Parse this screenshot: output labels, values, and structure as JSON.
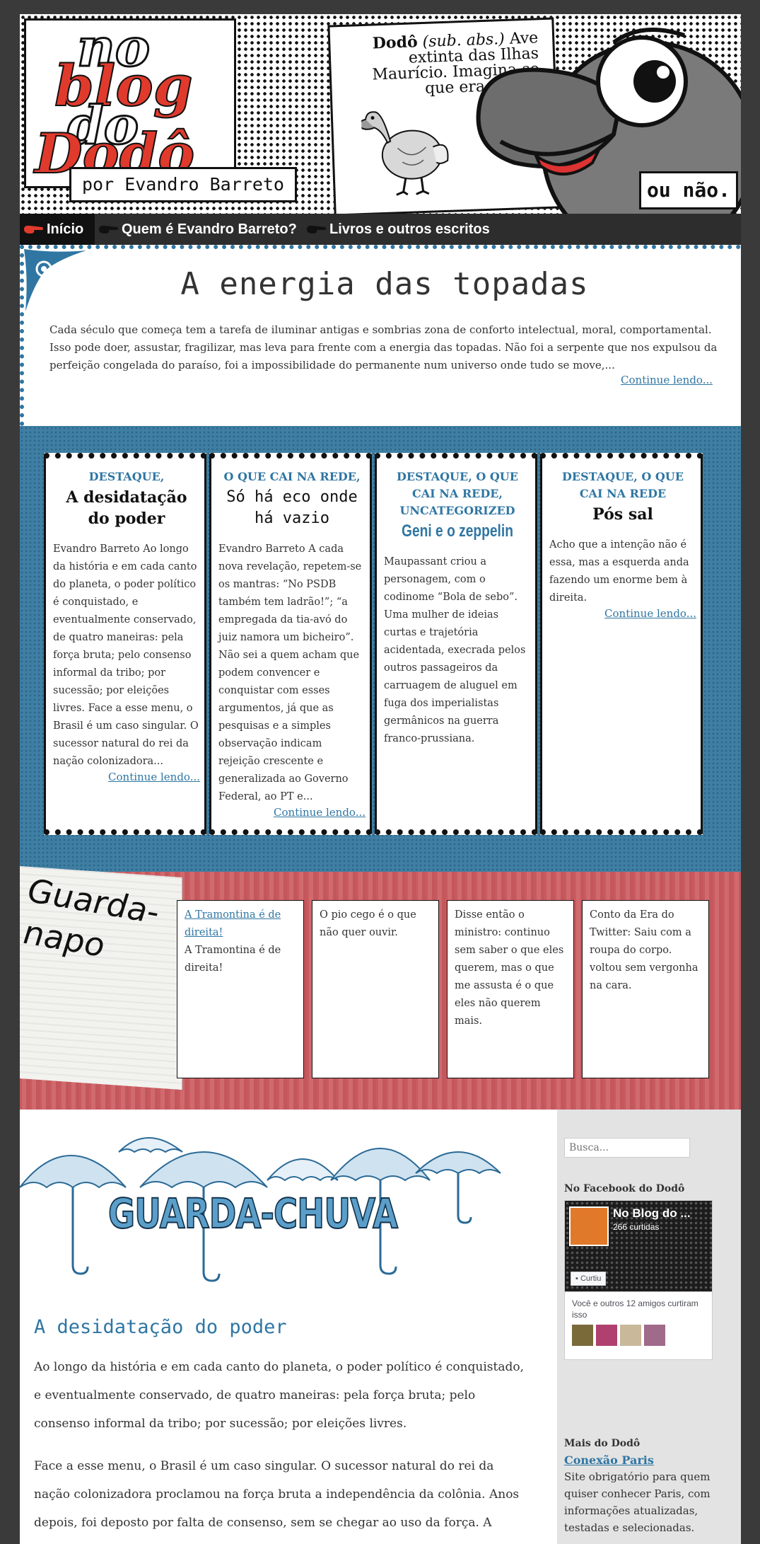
{
  "header": {
    "logo_no": "no",
    "logo_blog": "blog",
    "logo_do": "do",
    "logo_dodo": "Dodô",
    "byline": "por Evandro Barreto",
    "definition_term": "Dodô",
    "definition_abbr": "(sub. abs.)",
    "definition_text": "Ave extinta das Ilhas Maurício. Imagina-se que era assim.",
    "ou_nao": "ou não."
  },
  "nav": {
    "items": [
      {
        "label": "Início"
      },
      {
        "label": "Quem é Evandro Barreto?"
      },
      {
        "label": "Livros e outros escritos"
      }
    ]
  },
  "featured": {
    "title": "A energia das topadas",
    "excerpt": "Cada século que começa tem a tarefa de iluminar antigas e sombrias zona de conforto intelectual, moral, comportamental. Isso pode doer, assustar, fragilizar, mas leva para frente com a energia das topadas. Não foi a serpente que nos expulsou da perfeição congelada do paraíso, foi a impossibilidade do permanente num universo onde tudo se move,...",
    "more": "Continue lendo..."
  },
  "highlights": [
    {
      "category": "DESTAQUE,",
      "title": "A desidatação do poder",
      "text": "Evandro Barreto Ao longo da história e em cada canto do planeta, o poder político é conquistado, e eventualmente conservado, de quatro maneiras: pela força bruta; pelo consenso informal da tribo; por sucessão; por eleições livres. Face a esse menu, o Brasil é um caso singular. O sucessor natural do rei da nação colonizadora...",
      "more": "Continue lendo..."
    },
    {
      "category": "O QUE CAI NA REDE,",
      "title": "Só há eco onde há vazio",
      "text": "Evandro Barreto A  cada nova revelação, repetem-se os mantras: “No PSDB também tem ladrão!”;  “a empregada da tia-avó do juiz namora um bicheiro”.  Não sei a quem acham que podem convencer e conquistar com esses argumentos, já que as pesquisas e a simples observação indicam rejeição crescente e generalizada ao Governo Federal, ao PT e...",
      "more": "Continue lendo..."
    },
    {
      "category": "DESTAQUE, O QUE CAI NA REDE, UNCATEGORIZED",
      "title": "Geni e o zeppelin",
      "text": "Maupassant criou a personagem, com o codinome “Bola de sebo”. Uma mulher de ideias curtas e trajetória acidentada, execrada pelos outros passageiros da carruagem de aluguel em fuga dos imperialistas germânicos na guerra franco-prussiana.",
      "more": ""
    },
    {
      "category": "DESTAQUE, O QUE CAI NA REDE",
      "title": "Pós sal",
      "text": "Acho que a intenção não é essa, mas a esquerda anda fazendo  um enorme bem à direita.",
      "more": "Continue lendo..."
    }
  ],
  "guardanapo": {
    "label": "Guarda-napo",
    "cards": [
      {
        "link": "A Tramontina é de direita!",
        "text": "A Tramontina é de direita!"
      },
      {
        "link": "",
        "text": "O pio cego é o que não quer ouvir."
      },
      {
        "link": "",
        "text": "Disse então o ministro:  continuo sem saber o que eles querem, mas o que me assusta é o  que eles não querem mais."
      },
      {
        "link": "",
        "text": "Conto da Era do Twitter: Saiu com a roupa do corpo. voltou sem vergonha na cara."
      }
    ]
  },
  "main": {
    "banner": "GUARDA-CHUVA",
    "post_title": "A desidatação do poder",
    "paragraphs": [
      "Ao longo da história e em cada canto do planeta, o poder político é conquistado, e eventualmente conservado, de quatro maneiras: pela força bruta; pelo consenso informal da tribo; por sucessão; por eleições livres.",
      "Face a esse menu, o Brasil é um caso singular. O sucessor natural do rei da nação colonizadora proclamou na força bruta a independência da colônia.  Anos depois, foi deposto por falta de consenso, sem se chegar ao uso da força. A coroa caiu na cabeça do filho criança e, por mais de meio século, o país tornou-se a"
    ]
  },
  "sidebar": {
    "search_placeholder": "Busca...",
    "facebook_heading": "No Facebook do Dodô",
    "fb_page_name": "No Blog do ...",
    "fb_likes": "266 curtidas",
    "fb_button": "Curtiu",
    "fb_friends": "Você e outros 12 amigos curtiram isso",
    "mais_heading": "Mais do Dodô",
    "mais_link": "Conexão Paris",
    "mais_desc": "Site obrigatório para quem quiser conhecer Paris, com informações atualizadas, testadas e selecionadas."
  },
  "colors": {
    "accent_blue": "#2f76a3",
    "logo_red": "#e03a2d",
    "highlight_bg": "#3f7fa3",
    "guardanapo_bg": "#c85a60"
  }
}
